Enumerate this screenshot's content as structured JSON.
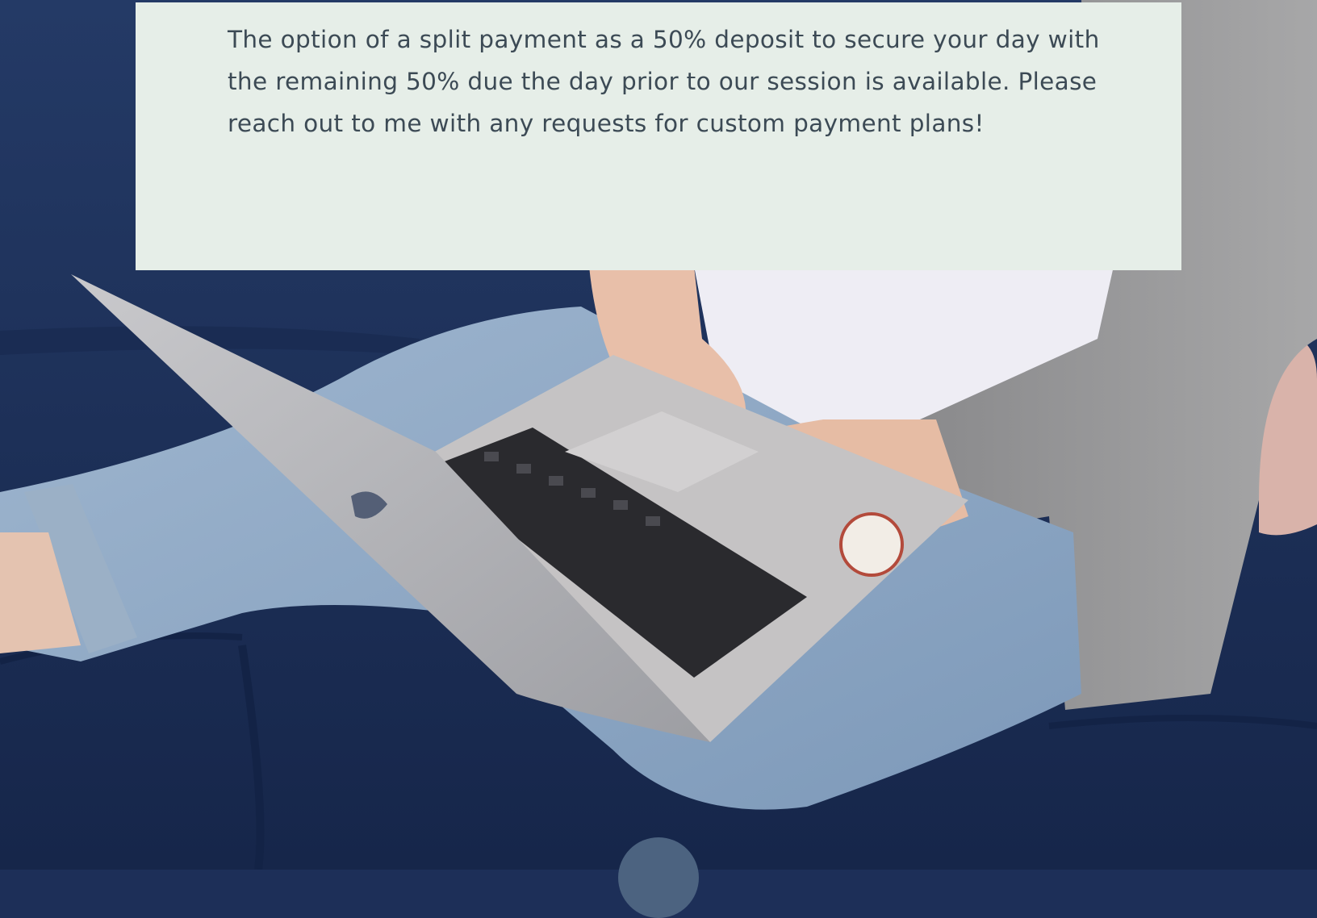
{
  "photo": {
    "description_icon": "woman-typing-on-laptop-photo"
  },
  "callout": {
    "text": "The option of a split payment as a 50% deposit to secure your day with the remaining 50% due the day prior to our session is available. Please reach out to me with any requests for custom payment plans!"
  },
  "colors": {
    "panel": "#e6eee8",
    "text": "#3c4a55",
    "sofa": "#1d2f58",
    "scroll_button": "#4c6380"
  }
}
